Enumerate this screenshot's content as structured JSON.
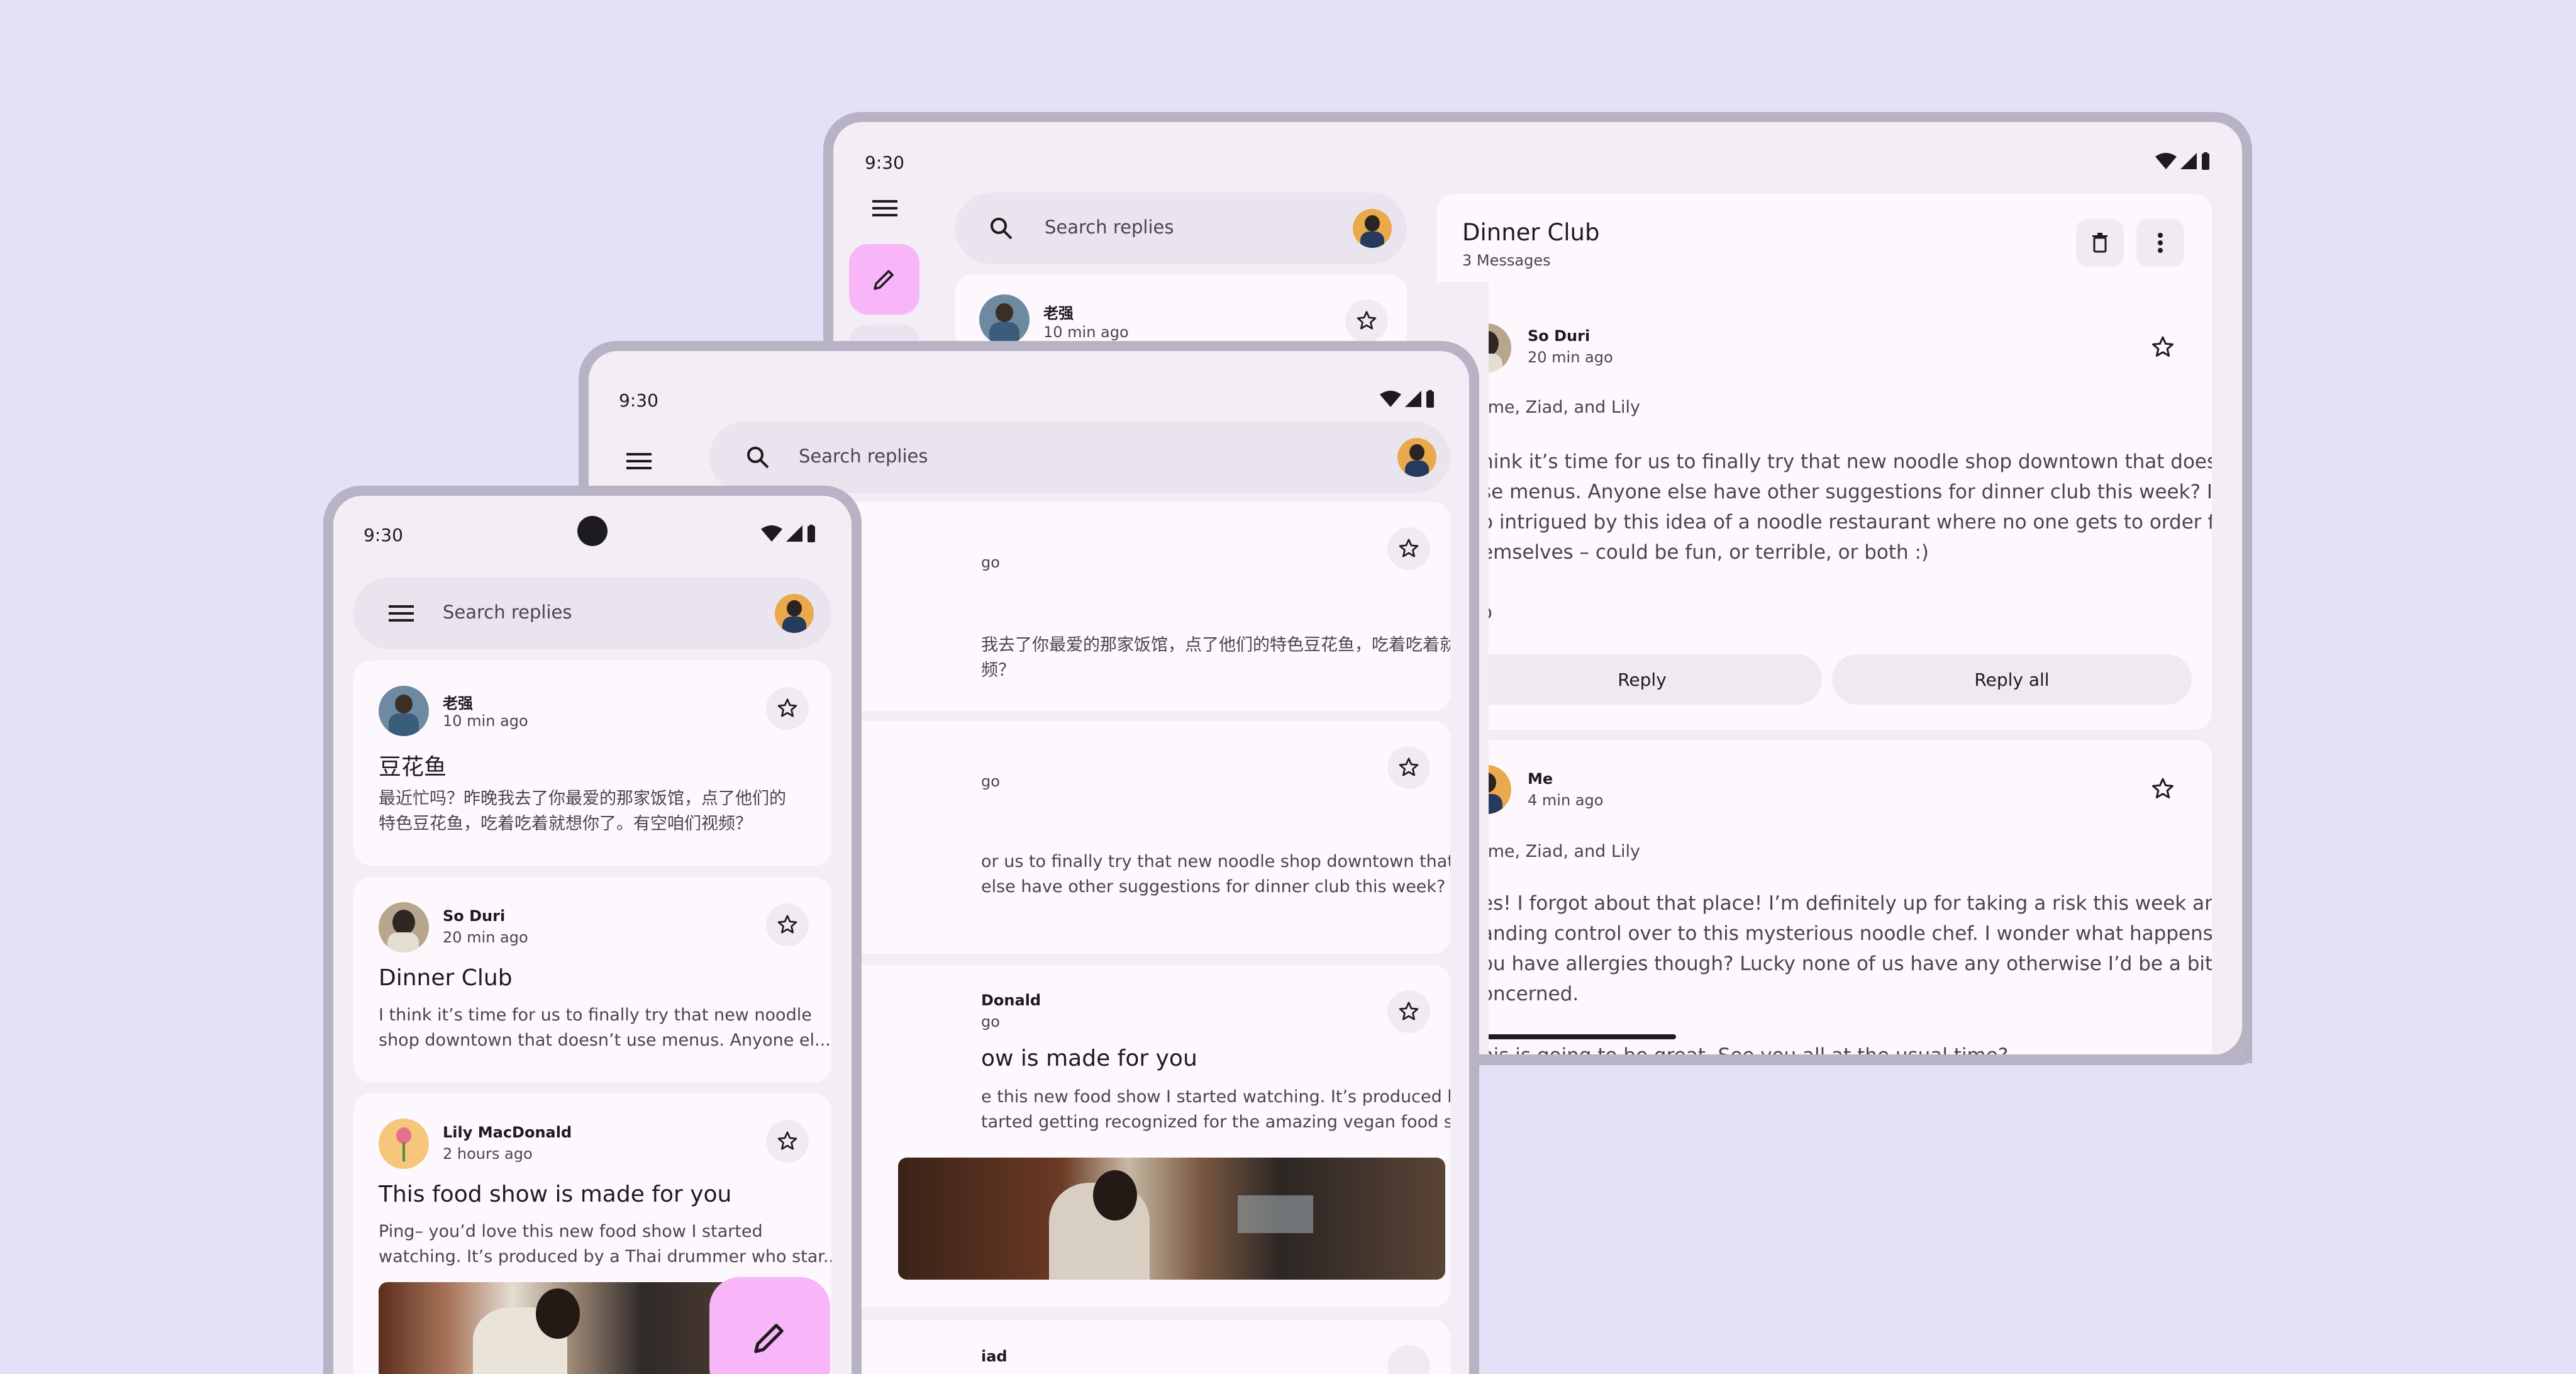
{
  "status": {
    "time": "9:30"
  },
  "search": {
    "placeholder": "Search replies"
  },
  "colors": {
    "background": "#e3e1f7",
    "fab": "#f8b5f7",
    "surface": "#f3eef6",
    "card": "#fdf8fd"
  },
  "phone": {
    "emails": [
      {
        "sender": "老强",
        "time": "10 min ago",
        "subject": "豆花鱼",
        "preview_line1": "最近忙吗？昨晚我去了你最爱的那家饭馆，点了他们的",
        "preview_line2": "特色豆花鱼，吃着吃着就想你了。有空咱们视频？"
      },
      {
        "sender": "So Duri",
        "time": "20 min ago",
        "subject": "Dinner Club",
        "preview_line1": "I think it’s time for us to finally try that new noodle",
        "preview_line2": "shop downtown that doesn’t use menus. Anyone el..."
      },
      {
        "sender": "Lily MacDonald",
        "time": "2 hours ago",
        "subject": "This food show is made for you",
        "preview_line1": "Ping– you’d love this new food show I started",
        "preview_line2": "watching. It’s produced by a Thai drummer who star..."
      }
    ]
  },
  "foldable": {
    "cards": [
      {
        "time_fragment": "go",
        "preview_line1": "我去了你最爱的那家饭馆，点了他们的特色豆花鱼，吃着吃着就想你",
        "preview_line2": "频？"
      },
      {
        "time_fragment": "go",
        "preview_line1": "or us to finally try that new noodle shop downtown that doesn’t use",
        "preview_line2": "else have other suggestions for dinner club this week? I’m so"
      },
      {
        "sender_fragment": "Donald",
        "time_fragment": "go",
        "subject_fragment": "ow is made for you",
        "preview_line1": "e this new food show I started watching. It’s produced by a Thai",
        "preview_line2": "tarted getting recognized for the amazing vegan food she always"
      }
    ],
    "partial_sender": "iad"
  },
  "tablet": {
    "list_item": {
      "sender": "老强",
      "time": "10 min ago"
    },
    "thread": {
      "title": "Dinner Club",
      "count": "3 Messages",
      "messages": [
        {
          "sender": "So Duri",
          "time": "20 min ago",
          "recipients": "me, Ziad, and Lily",
          "body": [
            "hink it’s time for us to finally try that new noodle shop downtown that doesn’t",
            "se menus. Anyone else have other suggestions for dinner club this week? I’m",
            "o intrigued by this idea of a noodle restaurant where no one gets to order for",
            "emselves – could be fun, or terrible, or both :)"
          ],
          "signoff_fragment": "o",
          "reply": "Reply",
          "reply_all": "Reply all"
        },
        {
          "sender": "Me",
          "time": "4 min ago",
          "recipients": "me, Ziad, and Lily",
          "body": [
            "es! I forgot about that place! I’m definitely up for taking a risk this week and",
            "anding control over to this mysterious noodle chef. I wonder what happens if",
            "ou have allergies though? Lucky none of us have any otherwise I’d be a bit",
            "oncerned."
          ],
          "cut_line": "his is going to be great. See you all at the usual time?"
        }
      ]
    }
  }
}
